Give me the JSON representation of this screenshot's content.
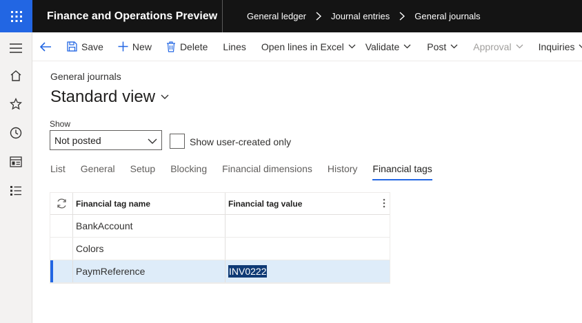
{
  "app": {
    "title": "Finance and Operations Preview"
  },
  "breadcrumb": [
    "General ledger",
    "Journal entries",
    "General journals"
  ],
  "actions": {
    "save": "Save",
    "new": "New",
    "delete": "Delete",
    "lines": "Lines",
    "open_in_excel": "Open lines in Excel",
    "validate": "Validate",
    "post": "Post",
    "approval": "Approval",
    "inquiries": "Inquiries"
  },
  "page": {
    "caption": "General journals",
    "view": "Standard view",
    "show_label": "Show",
    "show_value": "Not posted",
    "checkbox_label": "Show user-created only"
  },
  "tabs": [
    "List",
    "General",
    "Setup",
    "Blocking",
    "Financial dimensions",
    "History",
    "Financial tags"
  ],
  "active_tab": "Financial tags",
  "grid": {
    "columns": [
      "Financial tag name",
      "Financial tag value"
    ],
    "rows": [
      {
        "name": "BankAccount",
        "value": ""
      },
      {
        "name": "Colors",
        "value": ""
      },
      {
        "name": "PaymReference",
        "value": "INV0222"
      }
    ],
    "selected_row": 2
  },
  "colors": {
    "accent": "#2266e3",
    "topbar": "#141414",
    "selected_row": "#deecf9"
  },
  "icons": [
    "waffle-icon",
    "chevron-right-icon",
    "hamburger-icon",
    "home-icon",
    "star-icon",
    "clock-icon",
    "workspace-icon",
    "list-icon",
    "back-arrow-icon",
    "save-icon",
    "plus-icon",
    "trash-icon",
    "chevron-down-icon",
    "refresh-icon",
    "more-vertical-icon"
  ]
}
